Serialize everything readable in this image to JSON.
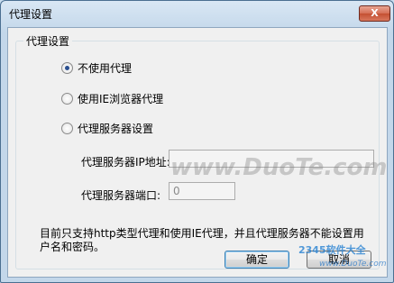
{
  "window": {
    "title": "代理设置",
    "close_label": "X"
  },
  "group": {
    "label": "代理设置"
  },
  "options": [
    {
      "label": "不使用代理",
      "checked": true
    },
    {
      "label": "使用IE浏览器代理",
      "checked": false
    },
    {
      "label": "代理服务器设置",
      "checked": false
    }
  ],
  "fields": {
    "address_label": "代理服务器IP地址:",
    "address_value": "",
    "port_label": "代理服务器端口:",
    "port_value": "0"
  },
  "note": "目前只支持http类型代理和使用IE代理，并且代理服务器不能设置用户名和密码。",
  "buttons": {
    "ok": "确定",
    "cancel": "取消"
  },
  "watermarks": {
    "center": "www.DuoTe.com",
    "logo": "2345软件大全",
    "logo_url": "www.DuoTe.com"
  }
}
